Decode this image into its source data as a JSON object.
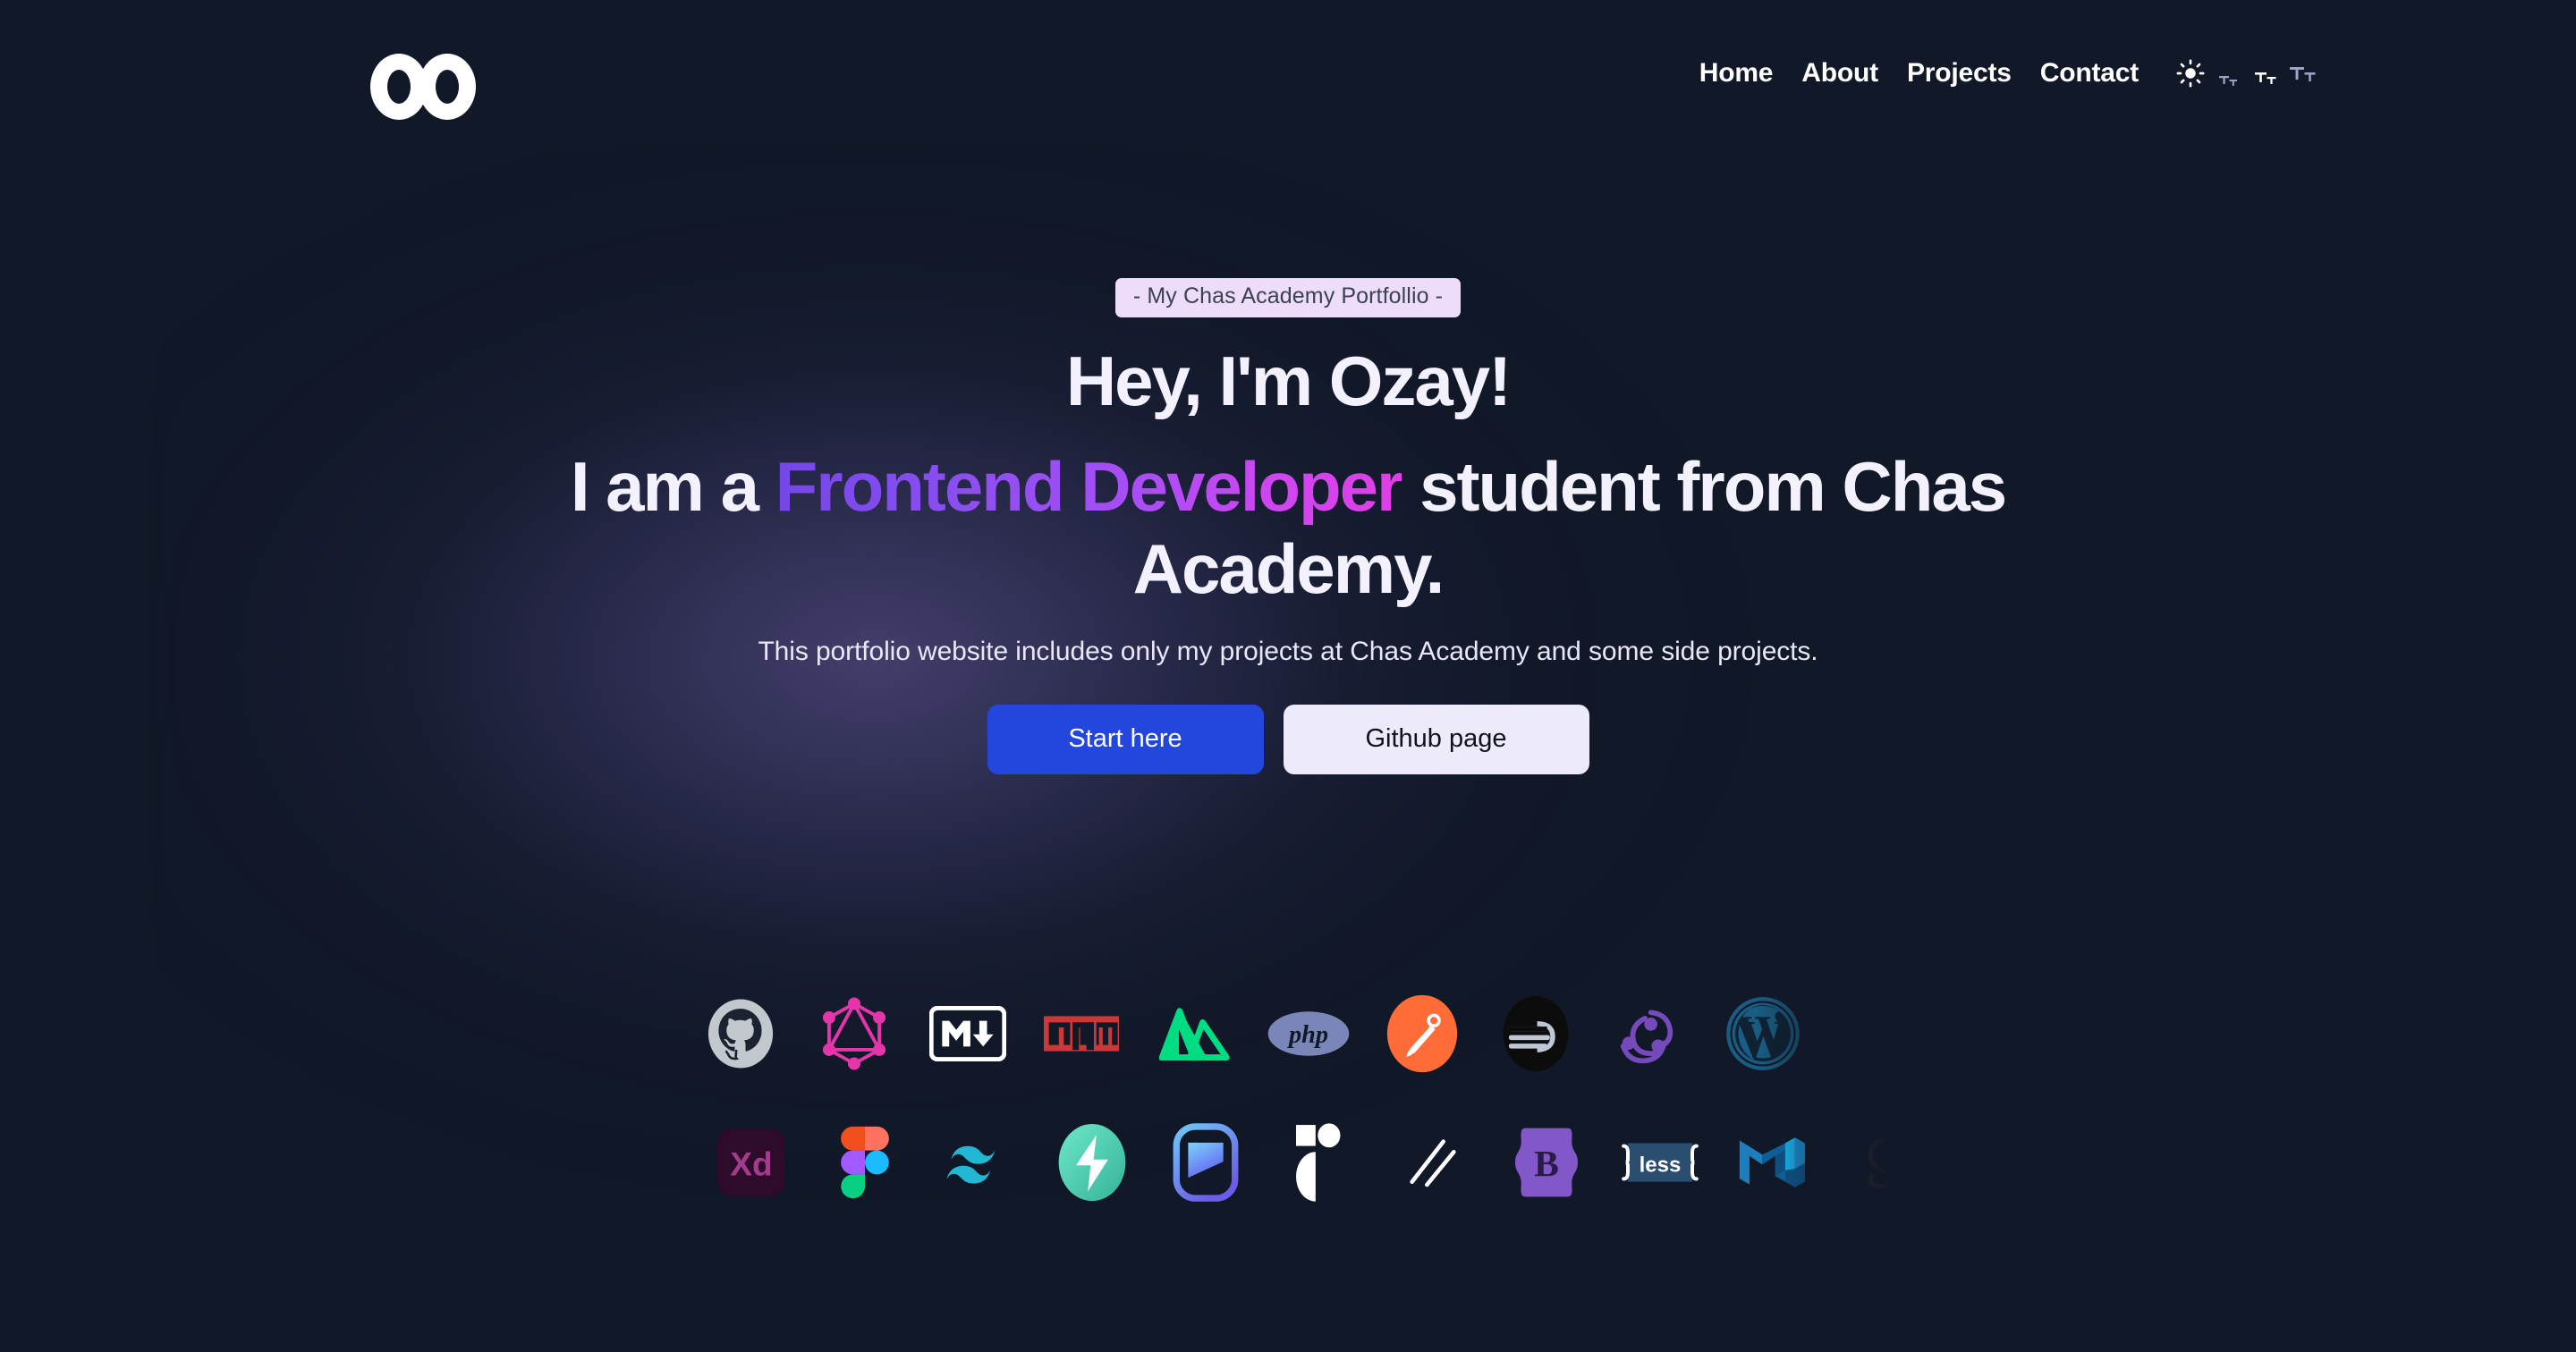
{
  "theme": {
    "background": "#111827",
    "glow": "#7062aa",
    "accent_blue": "#2347dd",
    "badge_bg": "#eddcfb",
    "badge_text": "#3b4252",
    "gradient_from": "#7547e8",
    "gradient_to": "#e03ee6",
    "text_light": "#f4f1fe"
  },
  "nav": {
    "logo_name": "infinity-oo-logo",
    "links": [
      {
        "label": "Home",
        "name": "nav-link-home"
      },
      {
        "label": "About",
        "name": "nav-link-about"
      },
      {
        "label": "Projects",
        "name": "nav-link-projects"
      },
      {
        "label": "Contact",
        "name": "nav-link-contact"
      }
    ],
    "theme_toggle": {
      "icon": "sun-icon",
      "state": "light-mode"
    },
    "font_size_controls": [
      {
        "label": "Tt",
        "size": "small",
        "active": false
      },
      {
        "label": "Tt",
        "size": "medium",
        "active": true
      },
      {
        "label": "Tt",
        "size": "large",
        "active": false
      }
    ]
  },
  "hero": {
    "badge": "- My Chas Academy Portfollio -",
    "heading": "Hey, I'm Ozay!",
    "subheading_pre": "I am a ",
    "subheading_highlight": "Frontend Developer",
    "subheading_post": " student from Chas Academy.",
    "lead": "This portfolio website includes only my projects at Chas Academy and some side projects.",
    "buttons": {
      "primary": "Start here",
      "secondary": "Github page"
    }
  },
  "marquee": {
    "row1": [
      {
        "name": "github-logo",
        "label": "GitHub"
      },
      {
        "name": "graphql-logo",
        "label": "GraphQL"
      },
      {
        "name": "markdown-logo",
        "label": "Markdown"
      },
      {
        "name": "npm-logo",
        "label": "npm"
      },
      {
        "name": "nuxt-logo",
        "label": "Nuxt"
      },
      {
        "name": "php-logo",
        "label": "PHP"
      },
      {
        "name": "postman-logo",
        "label": "Postman"
      },
      {
        "name": "prisma-logo",
        "label": "Prisma"
      },
      {
        "name": "redux-logo",
        "label": "Redux"
      },
      {
        "name": "wordpress-logo",
        "label": "WordPress"
      }
    ],
    "row2": [
      {
        "name": "adobe-xd-logo",
        "label": "Adobe XD"
      },
      {
        "name": "figma-logo",
        "label": "Figma"
      },
      {
        "name": "tailwindcss-logo",
        "label": "Tailwind CSS"
      },
      {
        "name": "supabase-logo",
        "label": "Supabase"
      },
      {
        "name": "framer-logo",
        "label": "Framer"
      },
      {
        "name": "radix-ui-logo",
        "label": "Radix UI"
      },
      {
        "name": "prettier-logo",
        "label": "Prettier"
      },
      {
        "name": "bootstrap-logo",
        "label": "Bootstrap"
      },
      {
        "name": "less-logo",
        "label": "Less"
      },
      {
        "name": "material-ui-logo",
        "label": "Material UI"
      },
      {
        "name": "sass-logo",
        "label": "Sass"
      }
    ]
  }
}
